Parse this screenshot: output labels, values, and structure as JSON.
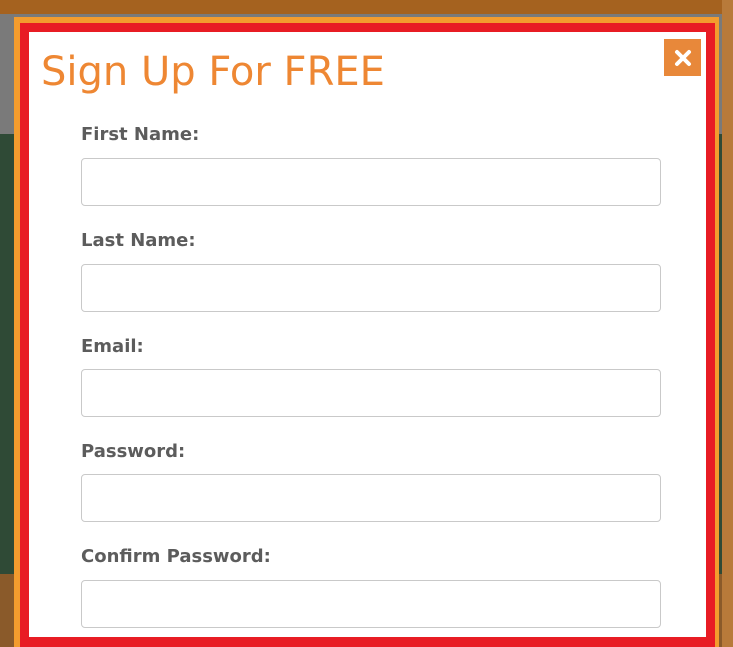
{
  "modal": {
    "title": "Sign Up For FREE",
    "close_icon": "close-x-icon",
    "colors": {
      "title": "#ee8733",
      "border_inner": "#e81c24",
      "border_outer": "#f39c2e",
      "close_bg": "#e8883a",
      "label": "#5c5c5c"
    }
  },
  "form": {
    "fields": [
      {
        "label": "First Name:",
        "value": ""
      },
      {
        "label": "Last Name:",
        "value": ""
      },
      {
        "label": "Email:",
        "value": ""
      },
      {
        "label": "Password:",
        "value": ""
      },
      {
        "label": "Confirm Password:",
        "value": ""
      }
    ]
  }
}
